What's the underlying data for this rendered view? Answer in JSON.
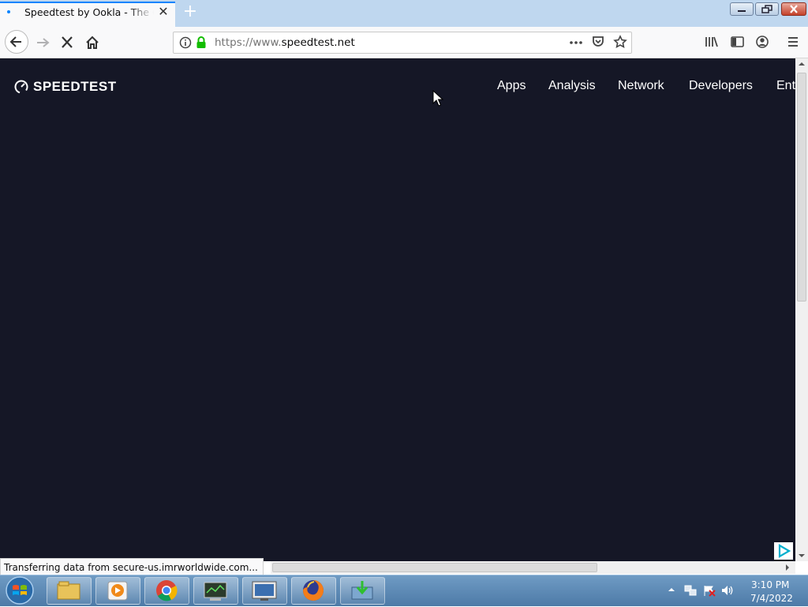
{
  "browser": {
    "tab_title": "Speedtest by Ookla - The Global Broadband Speed Test",
    "tab_close": "✕",
    "new_tab": "+",
    "url_prefix": "https://www.",
    "url_domain": "speedtest.net",
    "status_text": "Transferring data from secure-us.imrworldwide.com...",
    "icons": [
      "back-arrow-icon",
      "forward-arrow-icon",
      "stop-icon",
      "home-icon",
      "info-icon",
      "lock-icon",
      "page-actions-icon",
      "pocket-icon",
      "bookmark-star-icon",
      "library-icon",
      "sidebar-icon",
      "account-icon",
      "menu-icon"
    ]
  },
  "page": {
    "logo_text": "SPEEDTEST",
    "nav": [
      "Apps",
      "Analysis",
      "Network",
      "Developers",
      "Ent"
    ],
    "background_color": "#151726"
  },
  "taskbar": {
    "time": "3:10 PM",
    "date": "7/4/2022",
    "apps": [
      "file-explorer-icon",
      "media-player-icon",
      "chrome-icon",
      "monitor-app-icon",
      "display-settings-icon",
      "firefox-icon",
      "downloader-icon"
    ]
  }
}
